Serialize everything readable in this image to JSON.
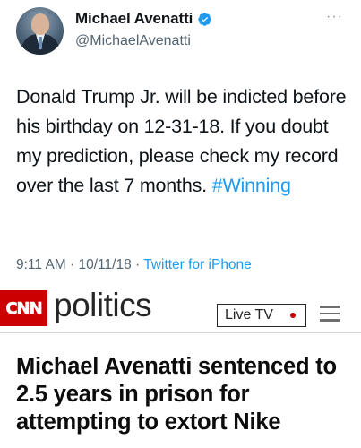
{
  "tweet": {
    "display_name": "Michael Avenatti",
    "handle": "@MichaelAvenatti",
    "verified": true,
    "more_icon": "more-horizontal-icon",
    "text_before_hashtag": "Donald Trump Jr. will be indicted before his birthday on 12-31-18. If you doubt my prediction, please check my record over the last 7 months. ",
    "hashtag": "#Winning",
    "time": "9:11 AM",
    "separator": " · ",
    "date": "10/11/18",
    "source": "Twitter for iPhone",
    "colors": {
      "link": "#1d9bf0",
      "secondary_text": "#536471"
    }
  },
  "cnn": {
    "logo_text": "CNN",
    "section": "politics",
    "live_tv_label": "Live TV",
    "menu_icon": "hamburger-menu-icon",
    "colors": {
      "brand_red": "#cc0000"
    }
  },
  "article": {
    "headline": "Michael Avenatti sentenced to 2.5 years in prison for attempting to extort Nike"
  }
}
